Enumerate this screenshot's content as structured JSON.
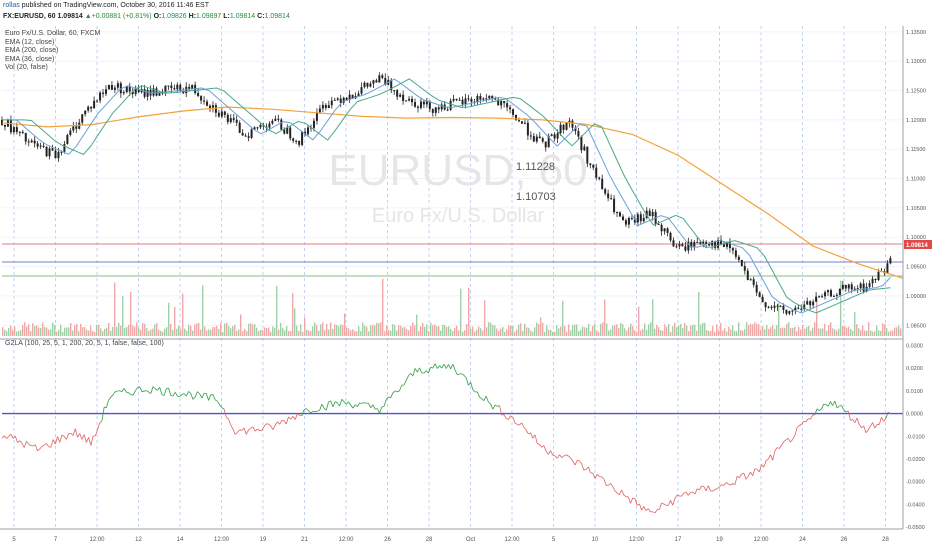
{
  "header": {
    "author": "rollas",
    "published": "published on TradingView.com, October 30, 2016 11:46 EST",
    "symbol": "FX:EURUSD, 60",
    "last": "1.09814",
    "change": "▲+0.00881 (+0.81%)",
    "ohlc_o_label": "O:",
    "ohlc_o": "1.09826",
    "ohlc_h_label": "H:",
    "ohlc_h": "1.09897",
    "ohlc_l_label": "L:",
    "ohlc_l": "1.09814",
    "ohlc_c_label": "C:",
    "ohlc_c": "1.09814"
  },
  "indicators": [
    "Euro Fx/U.S. Dollar, 60, FXCM",
    "EMA (12, close)",
    "EMA (200, close)",
    "EMA (36, close)",
    "Vol (20, false)"
  ],
  "oscillator_label": "G2LA (100, 25, 5, 1, 200, 20, 5, 1, false, false, 100)",
  "watermark": {
    "symbol": "EURUSD, 60",
    "name": "Euro Fx/U.S. Dollar"
  },
  "annotations": [
    "1.11228",
    "1.10703"
  ],
  "last_price_badge": "1.09814",
  "colors": {
    "ema_orange": "#f2a23a",
    "ema_teal": "#4aa88a",
    "ema_blue": "#6aa0d8",
    "candle": "#222222",
    "osc_pos": "#2f9e44",
    "osc_neg": "#e06060",
    "zero_line": "#5050d0",
    "badge": "#e24a4a",
    "grid_dash": "#b8c8e8"
  },
  "chart_data": [
    {
      "type": "line",
      "title": "EURUSD, 60",
      "xlabel": "",
      "ylabel": "",
      "y_ticks": [
        "1.13500",
        "1.13000",
        "1.12500",
        "1.12000",
        "1.11500",
        "1.11000",
        "1.10500",
        "1.10000",
        "1.09500",
        "1.09000",
        "1.08500"
      ],
      "x_ticks": [
        "5",
        "7",
        "12:00",
        "12",
        "14",
        "12:00",
        "19",
        "21",
        "12:00",
        "26",
        "28",
        "Oct",
        "12:00",
        "5",
        "10",
        "12:00",
        "17",
        "19",
        "12:00",
        "24",
        "26",
        "28"
      ],
      "ylim": [
        1.083,
        1.136
      ],
      "grid": true,
      "series": [
        {
          "name": "EMA (200, close)",
          "x": [
            0,
            5,
            10,
            15,
            20,
            25,
            30,
            35,
            40,
            45,
            50,
            55,
            60,
            65,
            70,
            75,
            80,
            85,
            90,
            95,
            100
          ],
          "values": [
            1.1195,
            1.1188,
            1.1192,
            1.1205,
            1.1215,
            1.1222,
            1.1218,
            1.1212,
            1.1206,
            1.1203,
            1.1204,
            1.1203,
            1.12,
            1.1192,
            1.1175,
            1.114,
            1.109,
            1.104,
            1.0985,
            1.0955,
            1.093
          ]
        },
        {
          "name": "Price",
          "x": [
            0,
            3,
            6,
            9,
            12,
            15,
            18,
            21,
            24,
            27,
            30,
            33,
            36,
            39,
            42,
            45,
            48,
            51,
            54,
            57,
            60,
            63,
            66,
            69,
            72,
            75,
            78,
            81,
            84,
            87,
            90,
            93,
            96,
            100
          ],
          "values": [
            1.12,
            1.116,
            1.114,
            1.121,
            1.126,
            1.1245,
            1.125,
            1.1255,
            1.1215,
            1.1175,
            1.12,
            1.1165,
            1.123,
            1.1245,
            1.127,
            1.1235,
            1.122,
            1.123,
            1.124,
            1.1205,
            1.1155,
            1.12,
            1.11,
            1.102,
            1.104,
            1.098,
            1.0995,
            1.098,
            1.0895,
            1.087,
            1.089,
            1.091,
            1.0915,
            1.0981
          ]
        }
      ]
    },
    {
      "type": "line",
      "title": "G2LA (100, 25, 5, 1, 200, 20, 5, 1, false, false, 100)",
      "y_ticks": [
        "0.0300",
        "0.0200",
        "0.0100",
        "0.0000",
        "-0.0100",
        "-0.0200",
        "-0.0300",
        "-0.0400",
        "-0.0500"
      ],
      "ylim": [
        -0.05,
        0.032
      ],
      "series": [
        {
          "name": "G2LA",
          "x": [
            0,
            4,
            8,
            10,
            12,
            16,
            20,
            24,
            26,
            30,
            34,
            38,
            42,
            46,
            50,
            54,
            58,
            60,
            64,
            68,
            72,
            76,
            80,
            84,
            88,
            92,
            96,
            100
          ],
          "values": [
            -0.009,
            -0.016,
            -0.008,
            -0.013,
            0.008,
            0.011,
            0.009,
            0.006,
            -0.008,
            -0.006,
            0.002,
            0.005,
            0.002,
            0.019,
            0.021,
            0.005,
            -0.006,
            -0.015,
            -0.022,
            -0.033,
            -0.044,
            -0.035,
            -0.032,
            -0.025,
            -0.009,
            0.006,
            -0.007,
            0.004
          ]
        }
      ]
    }
  ]
}
